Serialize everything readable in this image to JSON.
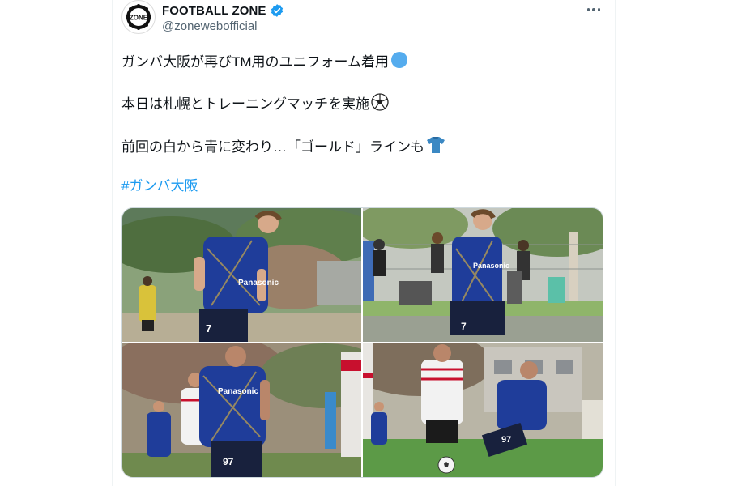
{
  "account": {
    "display_name": "FOOTBALL ZONE",
    "handle": "@zonewebofficial",
    "verified": true,
    "avatar_icon": "football-zone-logo",
    "avatar_text": "ZONE"
  },
  "tweet": {
    "line1": "ガンバ大阪が再びTM用のユニフォーム着用",
    "line1_emoji": "blue-circle-icon",
    "line2": "本日は札幌とトレーニングマッチを実施",
    "line2_emoji": "soccer-ball-icon",
    "line3": "前回の白から青に変わり…「ゴールド」ラインも",
    "line3_emoji": "shirt-icon",
    "hashtag": "#ガンバ大阪"
  },
  "media": {
    "photos": [
      {
        "alt": "player-7-dribbling",
        "jersey_number": "7",
        "sponsor": "Panasonic"
      },
      {
        "alt": "player-7-spectators",
        "jersey_number": "7",
        "sponsor": "Panasonic"
      },
      {
        "alt": "player-97-vs-sapporo",
        "jersey_number": "97",
        "sponsor": "Panasonic"
      },
      {
        "alt": "player-97-ball-contest",
        "jersey_number": "97",
        "sponsor": ""
      }
    ]
  },
  "colors": {
    "gamba_blue": "#1f3d9a",
    "link_blue": "#1d9bf0",
    "verified_blue": "#1d9bf0",
    "secondary_text": "#536471",
    "sapporo_red": "#c8102e"
  }
}
